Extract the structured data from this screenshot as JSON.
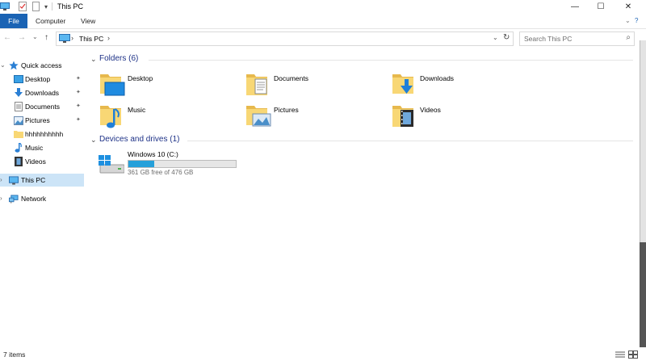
{
  "window": {
    "title": "This PC",
    "minimize": "—",
    "maximize": "☐",
    "close": "✕"
  },
  "ribbon": {
    "tabs": [
      "File",
      "Computer",
      "View"
    ],
    "collapse": "⌄",
    "help": "?"
  },
  "address": {
    "back": "←",
    "forward": "→",
    "recent": "⌄",
    "up": "↑",
    "path": "This PC",
    "chevron": "›",
    "dropdown": "⌄",
    "refresh": "↻"
  },
  "search": {
    "placeholder": "Search This PC",
    "icon": "⌕"
  },
  "nav": {
    "quick_access": "Quick access",
    "items": [
      {
        "label": "Desktop",
        "pinned": true
      },
      {
        "label": "Downloads",
        "pinned": true
      },
      {
        "label": "Documents",
        "pinned": true
      },
      {
        "label": "Pictures",
        "pinned": true
      },
      {
        "label": "hhhhhhhhhh",
        "pinned": false
      },
      {
        "label": "Music",
        "pinned": false
      },
      {
        "label": "Videos",
        "pinned": false
      }
    ],
    "this_pc": "This PC",
    "network": "Network",
    "pin_glyph": "📌"
  },
  "folders": {
    "header": "Folders (6)",
    "items": [
      "Desktop",
      "Documents",
      "Downloads",
      "Music",
      "Pictures",
      "Videos"
    ]
  },
  "devices": {
    "header": "Devices and drives (1)",
    "drive": {
      "name": "Windows 10 (C:)",
      "free_text": "361 GB free of 476 GB",
      "used_fraction": 0.24
    }
  },
  "status": {
    "items": "7 items"
  },
  "colors": {
    "accent": "#1a63b4",
    "selection": "#cce4f7",
    "folder": "#f8d775",
    "drive_fill": "#26a0da"
  }
}
